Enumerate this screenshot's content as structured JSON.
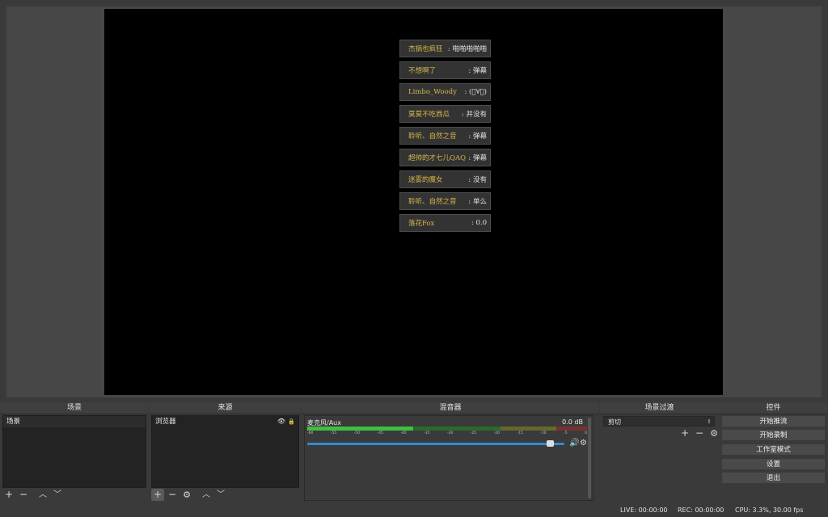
{
  "danmaku": [
    {
      "user": "杰锅也疯狂",
      "msg": ": 啪啪啪啪啪"
    },
    {
      "user": "不想啊了",
      "msg": ": 弹幕"
    },
    {
      "user": "Limbo_Woody",
      "msg": ": (ﾟ∀ﾟ)"
    },
    {
      "user": "莫莫不吃西瓜",
      "msg": ": 并没有"
    },
    {
      "user": "聆听、自然之音",
      "msg": ": 弹幕"
    },
    {
      "user": "超帅的才七儿QAQ",
      "msg": ": 弹幕"
    },
    {
      "user": "迷雾的魔女",
      "msg": ": 没有"
    },
    {
      "user": "聆听、自然之音",
      "msg": ": 单么"
    },
    {
      "user": "落花Fox",
      "msg": ": 0.0"
    }
  ],
  "scenes": {
    "title": "场景",
    "items": [
      "场景"
    ]
  },
  "sources": {
    "title": "来源",
    "items": [
      "浏览器"
    ]
  },
  "mixer": {
    "title": "混音器",
    "channel": "麦克风/Aux",
    "db": "0.0 dB",
    "ticks": [
      "-60",
      "-55",
      "-50",
      "-45",
      "-40",
      "-35",
      "-30",
      "-25",
      "-20",
      "-15",
      "-10",
      "-5",
      "0"
    ],
    "volume_level": 0.93,
    "meter_fill": 0.38
  },
  "transitions": {
    "title": "场景过渡",
    "selected": "剪切"
  },
  "controls": {
    "title": "控件",
    "buttons": [
      "开始推流",
      "开始录制",
      "工作室模式",
      "设置",
      "退出"
    ]
  },
  "status": {
    "live": "LIVE: 00:00:00",
    "rec": "REC: 00:00:00",
    "cpu": "CPU: 3.3%, 30.00 fps"
  },
  "icons": {
    "add": "+",
    "remove": "−",
    "up": "︿",
    "down": "﹀",
    "gear": "⚙",
    "eye": "👁",
    "lock": "🔒",
    "speaker": "🔊"
  },
  "colors": {
    "meter_green": "#3fbf3f",
    "meter_yellow": "#bfbf3f",
    "meter_red": "#bf3f3f",
    "volume_blue": "#2f8bd6",
    "danmaku_user": "#d6b84a"
  }
}
